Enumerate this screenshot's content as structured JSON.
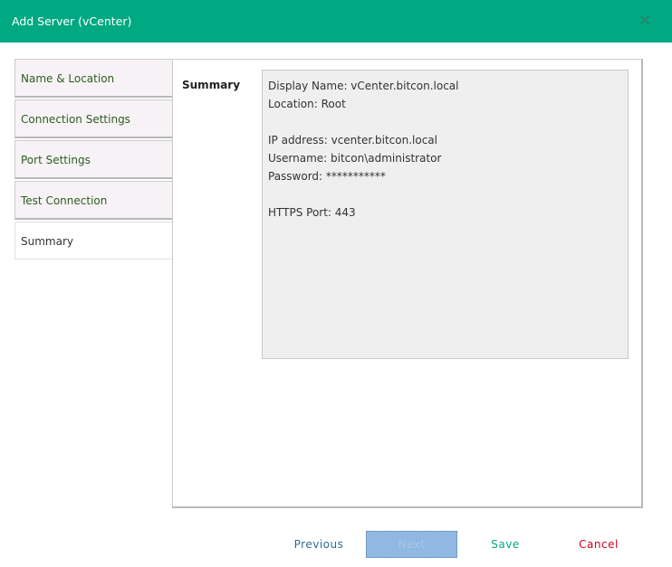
{
  "dialog": {
    "title": "Add Server (vCenter)",
    "close_symbol": "×"
  },
  "nav": {
    "items": [
      {
        "label": "Name & Location"
      },
      {
        "label": "Connection Settings"
      },
      {
        "label": "Port Settings"
      },
      {
        "label": "Test Connection"
      },
      {
        "label": "Summary"
      }
    ],
    "active": "Summary"
  },
  "summary": {
    "section_label": "Summary",
    "lines": [
      "Display Name: vCenter.bitcon.local",
      "Location: Root",
      "IP address: vcenter.bitcon.local",
      "Username: bitcon\\administrator",
      "Password: ***********",
      "HTTPS Port: 443"
    ]
  },
  "footer": {
    "previous_label": "Previous",
    "next_label": "Next",
    "save_label": "Save",
    "cancel_label": "Cancel"
  },
  "colors": {
    "header": "#01a982",
    "nav_text": "#2d5d22",
    "save": "#01a982",
    "cancel": "#d0021b",
    "previous": "#2b6c8f",
    "next_bg": "#90b8e2"
  }
}
